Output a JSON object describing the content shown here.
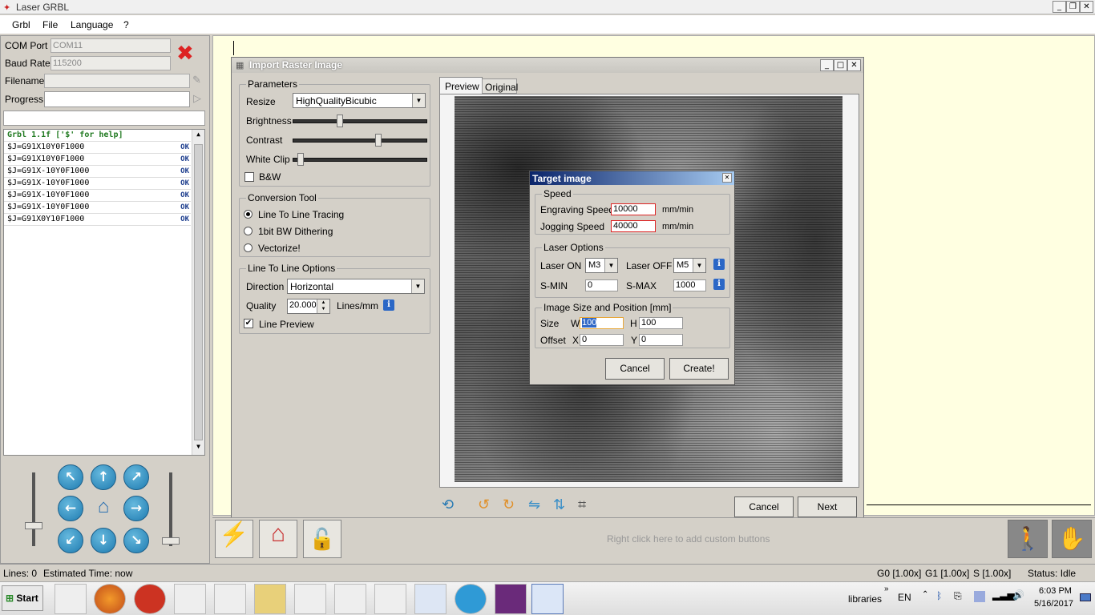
{
  "window": {
    "title": "Laser GRBL"
  },
  "menu": [
    "Grbl",
    "File",
    "Language",
    "?"
  ],
  "left": {
    "com_label": "COM Port",
    "com_value": "COM11",
    "baud_label": "Baud Rate",
    "baud_value": "115200",
    "file_label": "Filename",
    "progress_label": "Progress",
    "log_header": "Grbl 1.1f ['$' for help]",
    "log": [
      {
        "cmd": "$J=G91X10Y0F1000",
        "status": "OK"
      },
      {
        "cmd": "$J=G91X10Y0F1000",
        "status": "OK"
      },
      {
        "cmd": "$J=G91X-10Y0F1000",
        "status": "OK"
      },
      {
        "cmd": "$J=G91X-10Y0F1000",
        "status": "OK"
      },
      {
        "cmd": "$J=G91X-10Y0F1000",
        "status": "OK"
      },
      {
        "cmd": "$J=G91X-10Y0F1000",
        "status": "OK"
      },
      {
        "cmd": "$J=G91X0Y10F1000",
        "status": "OK"
      }
    ]
  },
  "import": {
    "title": "Import Raster Image",
    "params": "Parameters",
    "resize": "Resize",
    "resize_value": "HighQualityBicubic",
    "brightness": "Brightness",
    "contrast": "Contrast",
    "whiteclip": "White Clip",
    "bw": "B&W",
    "conv": "Conversion Tool",
    "conv_opts": [
      "Line To Line Tracing",
      "1bit BW Dithering",
      "Vectorize!"
    ],
    "ltl": "Line To Line Options",
    "direction": "Direction",
    "direction_value": "Horizontal",
    "quality": "Quality",
    "quality_value": "20.000",
    "quality_unit": "Lines/mm",
    "line_preview": "Line Preview",
    "tab_preview": "Preview",
    "tab_original": "Original",
    "cancel": "Cancel",
    "next": "Next"
  },
  "target": {
    "title": "Target image",
    "speed": "Speed",
    "engr_label": "Engraving Speed",
    "engr_value": "10000",
    "jog_label": "Jogging Speed",
    "jog_value": "40000",
    "unit": "mm/min",
    "laser": "Laser Options",
    "on_label": "Laser ON",
    "on_value": "M3",
    "off_label": "Laser OFF",
    "off_value": "M5",
    "smin_label": "S-MIN",
    "smin_value": "0",
    "smax_label": "S-MAX",
    "smax_value": "1000",
    "size_group": "Image Size and Position [mm]",
    "size_label": "Size",
    "w_label": "W",
    "w_value": "100",
    "h_label": "H",
    "h_value": "100",
    "offset_label": "Offset",
    "x_label": "X",
    "x_value": "0",
    "y_label": "Y",
    "y_value": "0",
    "cancel": "Cancel",
    "create": "Create!"
  },
  "custom_hint": "Right click here to add custom buttons",
  "status": {
    "lines": "Lines:  0",
    "est": "Estimated Time:  now",
    "g0": "G0 [1.00x]",
    "g1": "G1 [1.00x]",
    "s": "S [1.00x]",
    "state": "Status:  Idle"
  },
  "taskbar": {
    "start": "Start",
    "libraries": "libraries",
    "lang": "EN",
    "time": "6:03 PM",
    "date": "5/16/2017"
  }
}
